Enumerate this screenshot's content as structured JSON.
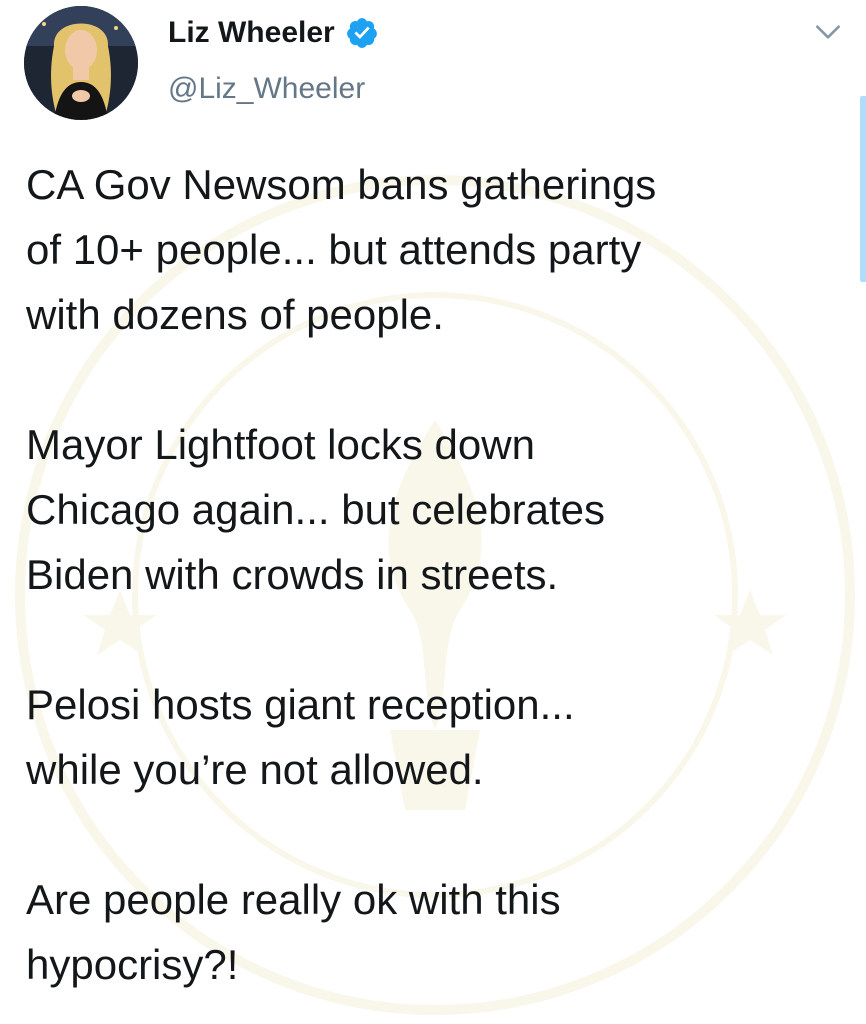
{
  "author": {
    "display_name": "Liz Wheeler",
    "handle": "@Liz_Wheeler",
    "verified": true
  },
  "tweet": {
    "paragraphs": [
      "CA Gov Newsom bans gatherings\nof 10+ people... but attends party\nwith dozens of people.",
      "Mayor Lightfoot locks down\nChicago again... but celebrates\nBiden with crowds in streets.",
      "Pelosi hosts giant reception...\nwhile you’re not allowed.",
      "Are people really ok with this\nhypocrisy?!"
    ]
  },
  "icons": {
    "verified": "verified-badge-icon",
    "menu": "chevron-down-icon"
  },
  "colors": {
    "text": "#14171a",
    "secondary": "#657786",
    "verified": "#1da1f2",
    "watermark": "#c9a227"
  }
}
